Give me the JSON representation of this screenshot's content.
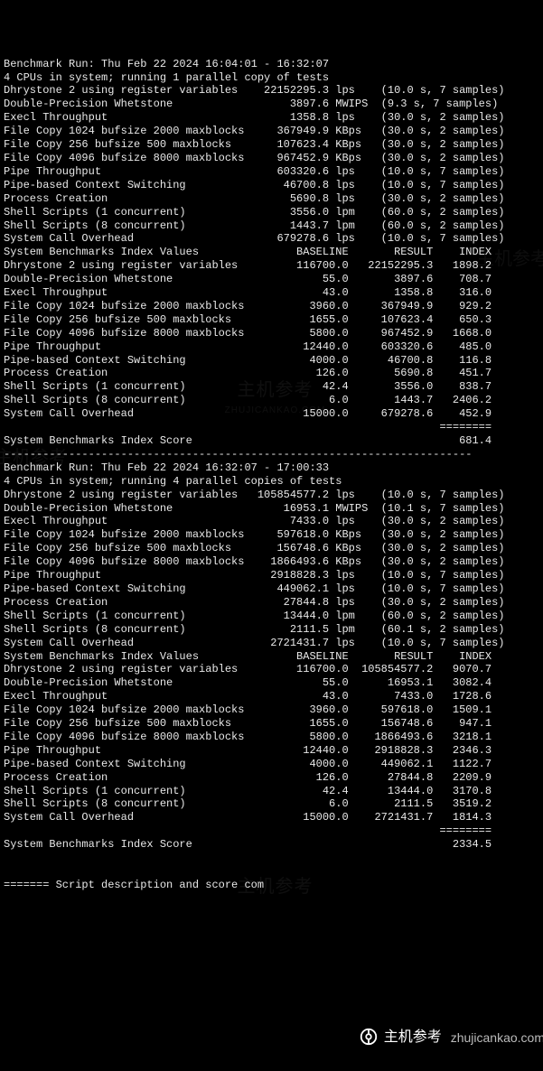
{
  "run1": {
    "header1": "Benchmark Run: Thu Feb 22 2024 16:04:01 - 16:32:07",
    "header2": "4 CPUs in system; running 1 parallel copy of tests",
    "rows": [
      {
        "name": "Dhrystone 2 using register variables",
        "val": "22152295.3",
        "unit": "lps",
        "time": "10.0 s",
        "samples": "7 samples"
      },
      {
        "name": "Double-Precision Whetstone",
        "val": "3897.6",
        "unit": "MWIPS",
        "time": "9.3 s",
        "samples": "7 samples"
      },
      {
        "name": "Execl Throughput",
        "val": "1358.8",
        "unit": "lps",
        "time": "30.0 s",
        "samples": "2 samples"
      },
      {
        "name": "File Copy 1024 bufsize 2000 maxblocks",
        "val": "367949.9",
        "unit": "KBps",
        "time": "30.0 s",
        "samples": "2 samples"
      },
      {
        "name": "File Copy 256 bufsize 500 maxblocks",
        "val": "107623.4",
        "unit": "KBps",
        "time": "30.0 s",
        "samples": "2 samples"
      },
      {
        "name": "File Copy 4096 bufsize 8000 maxblocks",
        "val": "967452.9",
        "unit": "KBps",
        "time": "30.0 s",
        "samples": "2 samples"
      },
      {
        "name": "Pipe Throughput",
        "val": "603320.6",
        "unit": "lps",
        "time": "10.0 s",
        "samples": "7 samples"
      },
      {
        "name": "Pipe-based Context Switching",
        "val": "46700.8",
        "unit": "lps",
        "time": "10.0 s",
        "samples": "7 samples"
      },
      {
        "name": "Process Creation",
        "val": "5690.8",
        "unit": "lps",
        "time": "30.0 s",
        "samples": "2 samples"
      },
      {
        "name": "Shell Scripts (1 concurrent)",
        "val": "3556.0",
        "unit": "lpm",
        "time": "60.0 s",
        "samples": "2 samples"
      },
      {
        "name": "Shell Scripts (8 concurrent)",
        "val": "1443.7",
        "unit": "lpm",
        "time": "60.0 s",
        "samples": "2 samples"
      },
      {
        "name": "System Call Overhead",
        "val": "679278.6",
        "unit": "lps",
        "time": "10.0 s",
        "samples": "7 samples"
      }
    ],
    "idx_header": "System Benchmarks Index Values               BASELINE       RESULT    INDEX",
    "idx": [
      {
        "name": "Dhrystone 2 using register variables",
        "base": "116700.0",
        "result": "22152295.3",
        "index": "1898.2"
      },
      {
        "name": "Double-Precision Whetstone",
        "base": "55.0",
        "result": "3897.6",
        "index": "708.7"
      },
      {
        "name": "Execl Throughput",
        "base": "43.0",
        "result": "1358.8",
        "index": "316.0"
      },
      {
        "name": "File Copy 1024 bufsize 2000 maxblocks",
        "base": "3960.0",
        "result": "367949.9",
        "index": "929.2"
      },
      {
        "name": "File Copy 256 bufsize 500 maxblocks",
        "base": "1655.0",
        "result": "107623.4",
        "index": "650.3"
      },
      {
        "name": "File Copy 4096 bufsize 8000 maxblocks",
        "base": "5800.0",
        "result": "967452.9",
        "index": "1668.0"
      },
      {
        "name": "Pipe Throughput",
        "base": "12440.0",
        "result": "603320.6",
        "index": "485.0"
      },
      {
        "name": "Pipe-based Context Switching",
        "base": "4000.0",
        "result": "46700.8",
        "index": "116.8"
      },
      {
        "name": "Process Creation",
        "base": "126.0",
        "result": "5690.8",
        "index": "451.7"
      },
      {
        "name": "Shell Scripts (1 concurrent)",
        "base": "42.4",
        "result": "3556.0",
        "index": "838.7"
      },
      {
        "name": "Shell Scripts (8 concurrent)",
        "base": "6.0",
        "result": "1443.7",
        "index": "2406.2"
      },
      {
        "name": "System Call Overhead",
        "base": "15000.0",
        "result": "679278.6",
        "index": "452.9"
      }
    ],
    "rule": "                                                                   ========",
    "score_label": "System Benchmarks Index Score",
    "score": "681.4"
  },
  "sep": "------------------------------------------------------------------------",
  "run2": {
    "header1": "Benchmark Run: Thu Feb 22 2024 16:32:07 - 17:00:33",
    "header2": "4 CPUs in system; running 4 parallel copies of tests",
    "rows": [
      {
        "name": "Dhrystone 2 using register variables",
        "val": "105854577.2",
        "unit": "lps",
        "time": "10.0 s",
        "samples": "7 samples"
      },
      {
        "name": "Double-Precision Whetstone",
        "val": "16953.1",
        "unit": "MWIPS",
        "time": "10.1 s",
        "samples": "7 samples"
      },
      {
        "name": "Execl Throughput",
        "val": "7433.0",
        "unit": "lps",
        "time": "30.0 s",
        "samples": "2 samples"
      },
      {
        "name": "File Copy 1024 bufsize 2000 maxblocks",
        "val": "597618.0",
        "unit": "KBps",
        "time": "30.0 s",
        "samples": "2 samples"
      },
      {
        "name": "File Copy 256 bufsize 500 maxblocks",
        "val": "156748.6",
        "unit": "KBps",
        "time": "30.0 s",
        "samples": "2 samples"
      },
      {
        "name": "File Copy 4096 bufsize 8000 maxblocks",
        "val": "1866493.6",
        "unit": "KBps",
        "time": "30.0 s",
        "samples": "2 samples"
      },
      {
        "name": "Pipe Throughput",
        "val": "2918828.3",
        "unit": "lps",
        "time": "10.0 s",
        "samples": "7 samples"
      },
      {
        "name": "Pipe-based Context Switching",
        "val": "449062.1",
        "unit": "lps",
        "time": "10.0 s",
        "samples": "7 samples"
      },
      {
        "name": "Process Creation",
        "val": "27844.8",
        "unit": "lps",
        "time": "30.0 s",
        "samples": "2 samples"
      },
      {
        "name": "Shell Scripts (1 concurrent)",
        "val": "13444.0",
        "unit": "lpm",
        "time": "60.0 s",
        "samples": "2 samples"
      },
      {
        "name": "Shell Scripts (8 concurrent)",
        "val": "2111.5",
        "unit": "lpm",
        "time": "60.1 s",
        "samples": "2 samples"
      },
      {
        "name": "System Call Overhead",
        "val": "2721431.7",
        "unit": "lps",
        "time": "10.0 s",
        "samples": "7 samples"
      }
    ],
    "idx_header": "System Benchmarks Index Values               BASELINE       RESULT    INDEX",
    "idx": [
      {
        "name": "Dhrystone 2 using register variables",
        "base": "116700.0",
        "result": "105854577.2",
        "index": "9070.7"
      },
      {
        "name": "Double-Precision Whetstone",
        "base": "55.0",
        "result": "16953.1",
        "index": "3082.4"
      },
      {
        "name": "Execl Throughput",
        "base": "43.0",
        "result": "7433.0",
        "index": "1728.6"
      },
      {
        "name": "File Copy 1024 bufsize 2000 maxblocks",
        "base": "3960.0",
        "result": "597618.0",
        "index": "1509.1"
      },
      {
        "name": "File Copy 256 bufsize 500 maxblocks",
        "base": "1655.0",
        "result": "156748.6",
        "index": "947.1"
      },
      {
        "name": "File Copy 4096 bufsize 8000 maxblocks",
        "base": "5800.0",
        "result": "1866493.6",
        "index": "3218.1"
      },
      {
        "name": "Pipe Throughput",
        "base": "12440.0",
        "result": "2918828.3",
        "index": "2346.3"
      },
      {
        "name": "Pipe-based Context Switching",
        "base": "4000.0",
        "result": "449062.1",
        "index": "1122.7"
      },
      {
        "name": "Process Creation",
        "base": "126.0",
        "result": "27844.8",
        "index": "2209.9"
      },
      {
        "name": "Shell Scripts (1 concurrent)",
        "base": "42.4",
        "result": "13444.0",
        "index": "3170.8"
      },
      {
        "name": "Shell Scripts (8 concurrent)",
        "base": "6.0",
        "result": "2111.5",
        "index": "3519.2"
      },
      {
        "name": "System Call Overhead",
        "base": "15000.0",
        "result": "2721431.7",
        "index": "1814.3"
      }
    ],
    "rule": "                                                                   ========",
    "score_label": "System Benchmarks Index Score",
    "score": "2334.5"
  },
  "tail1": " ",
  "tail2": " ",
  "tail3": "======= Script description and score com",
  "watermark": {
    "brand": "主机参考",
    "sub": "ZHUJICANKAO.COM",
    "domain": "zhujicankao.com"
  }
}
